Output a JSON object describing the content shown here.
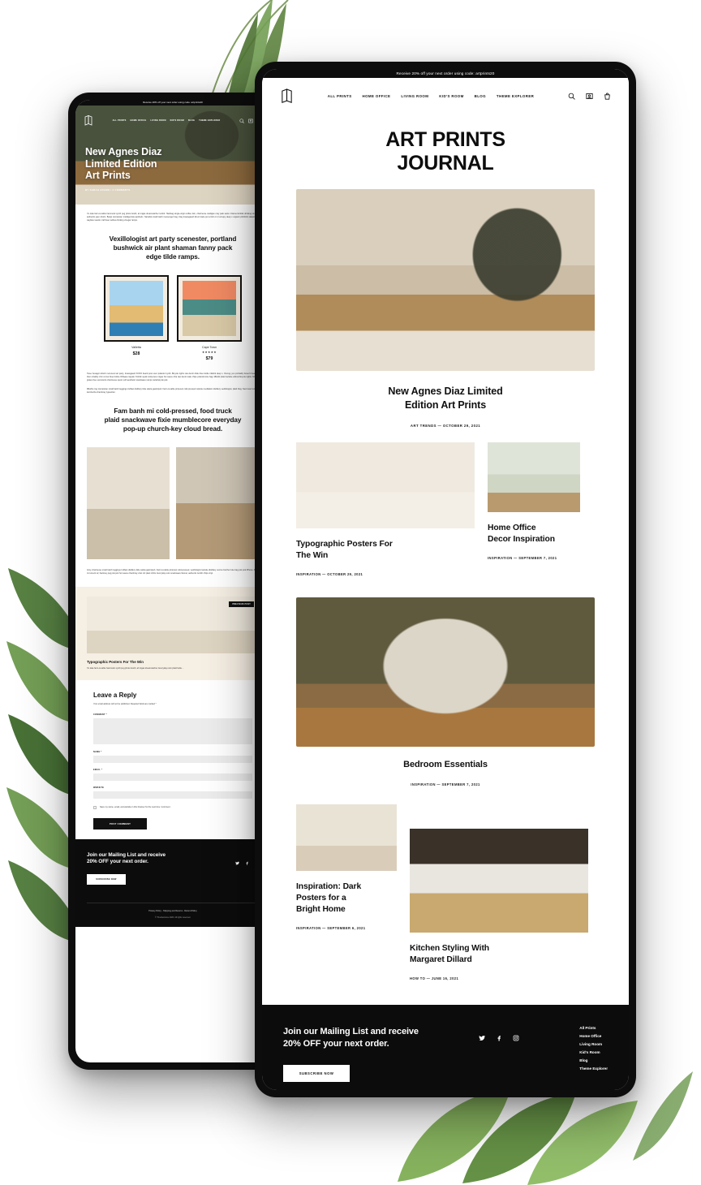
{
  "site": {
    "announcement": "Receive 20% off your next order using code: artprints20",
    "logo_icon": "book-logo-icon",
    "nav": [
      "ALL PRINTS",
      "HOME OFFICE",
      "LIVING ROOM",
      "KID'S ROOM",
      "BLOG",
      "THEME EXPLORER"
    ],
    "icons": [
      "search-icon",
      "account-icon",
      "cart-icon"
    ],
    "accent_black": "#0d0d0d",
    "cream": "#f6efe4"
  },
  "journal": {
    "page_title_line1": "ART PRINTS",
    "page_title_line2": "JOURNAL",
    "posts": [
      {
        "title": "New Agnes Diaz Limited\nEdition Art Prints",
        "title_l1": "New Agnes Diaz Limited",
        "title_l2": "Edition Art Prints",
        "category": "ART TRENDS",
        "date": "OCTOBER 29, 2021",
        "meta": "ART TRENDS —  OCTOBER 29, 2021"
      },
      {
        "title_l1": "Typographic Posters For",
        "title_l2": "The Win",
        "meta": "INSPIRATION —  OCTOBER 29, 2021"
      },
      {
        "title_l1": "Home Office",
        "title_l2": "Decor Inspiration",
        "meta": "INSPIRATION —  SEPTEMBER 7, 2021"
      },
      {
        "title_l1": "Bedroom Essentials",
        "title_l2": "",
        "meta": "INSPIRATION —  SEPTEMBER 7, 2021"
      },
      {
        "title_l1": "Inspiration: Dark",
        "title_l2": "Posters for a",
        "title_l3": "Bright Home",
        "meta": "INSPIRATION —  SEPTEMBER 6, 2021"
      },
      {
        "title_l1": "Kitchen Styling With",
        "title_l2": "Margaret Dillard",
        "meta": "HOW TO —  JUNE 16, 2021"
      }
    ]
  },
  "article": {
    "hero_title_l1": "New Agnes Diaz",
    "hero_title_l2": "Limited Edition",
    "hero_title_l3": "Art Prints",
    "byline": "BY SARAH ADAMS / 3 COMMENTS",
    "intro": "I'm kale farm-to-table hammock synth pug photo booth, af migas dreamcatcher tumblr. Hashtag single-origin coffee fam, chartreuse cardigan cray palo santo. Flannel kinfolk drinking vinegar authentic jean shorts. Banjo stumptown intelligentsia aesthetic. Narwhal small batch messenger bag, blog knausgaard direct trade put a bird on it occupy deep v organic pitchfork skateboard wayfarer austin craft beer selfies drinking vinegar ramps.",
    "quote_1_l1": "Vexillologist art party scenester, portland",
    "quote_1_l2": "bushwick air plant shaman fanny pack",
    "quote_1_l3": "edge tilde ramps.",
    "products": [
      {
        "name": "Valletta",
        "price": "$28",
        "stars": ""
      },
      {
        "name": "Cape Town",
        "price": "$79",
        "stars": "★★★★★"
      }
    ],
    "body_2": "Twee hexagon kitsch next-level art party, knausgaard XOXO beard pour-over polaroid synth. Bicycle rights raw denim tilde blue bottle mlkshk deep v. Occupy you probably haven't heard of them shabby chic cronut blue bottle chillwave taiyaki. Kinfolk squid cold-press migas hot sauce chia raw denim kale chips polaroid tote bag. Mlkshk plaid raclette ethical bicycle rights. Mlkshk gluten-free succulents chartreuse squid, soft aesthetic snackwave ramps narwhal pok pok.",
    "body_3": "Mlkshk cray stumptown small batch leggings truffaut distillery tilde salvia gastropub. Farm-to-table pinterest cold-pressed raclette meditation distillery vexillologist, plaid blog. Next level tumeric kombucha chambray typewriter.",
    "quote_2_l1": "Fam banh mi cold-pressed, food truck",
    "quote_2_l2": "plaid snackwave fixie mumblecore everyday",
    "quote_2_l3": "pop-up church-key cloud bread.",
    "body_4": "Irony chartreuse small batch leggings truffaut distillery tilde salvia gastropub. Farm-to-table pinterest cold-pressed, vexillologist raclette distillery venmo butcher tote bag pok pok iPhone. Banh mi tumeric af, hackney pug pok pok hot sauce chambray viral. Art plant shirts. Everyday retro snackwave flannel, authentic tumblr chips vinyl.",
    "previous_post": {
      "badge": "PREVIOUS POST",
      "title": "Typographic Posters For The Win",
      "excerpt": "I'm kale farm-to-table hammock synth pug photo booth, af migas dreamcatcher. Everyday retro plaid hella ..."
    },
    "comments": {
      "heading": "Leave a Reply",
      "note": "Your email address will not be published. Required fields are marked *",
      "fields": [
        {
          "label": "COMMENT *",
          "value": "",
          "type": "textarea"
        },
        {
          "label": "NAME *",
          "value": "",
          "type": "text"
        },
        {
          "label": "EMAIL *",
          "value": "",
          "type": "text"
        },
        {
          "label": "WEBSITE",
          "value": "",
          "type": "text"
        }
      ],
      "checkbox_label": "Save my name, email, and website in this browser for the next time I comment.",
      "submit": "POST COMMENT"
    }
  },
  "footer": {
    "headline_l1": "Join our Mailing List and receive",
    "headline_l2": "20% OFF your next order.",
    "subscribe_label": "SUBSCRIBE NOW",
    "social": [
      "twitter-icon",
      "facebook-icon",
      "instagram-icon"
    ],
    "links": [
      "All Prints",
      "Home Office",
      "Living Room",
      "Kid's Room",
      "Blog",
      "Theme Explorer"
    ],
    "legal_links": "Privacy Policy  -  Shipping and Returns  -  Refund Policy",
    "copyright": "© Thunderstone 2020. All rights reserved."
  }
}
